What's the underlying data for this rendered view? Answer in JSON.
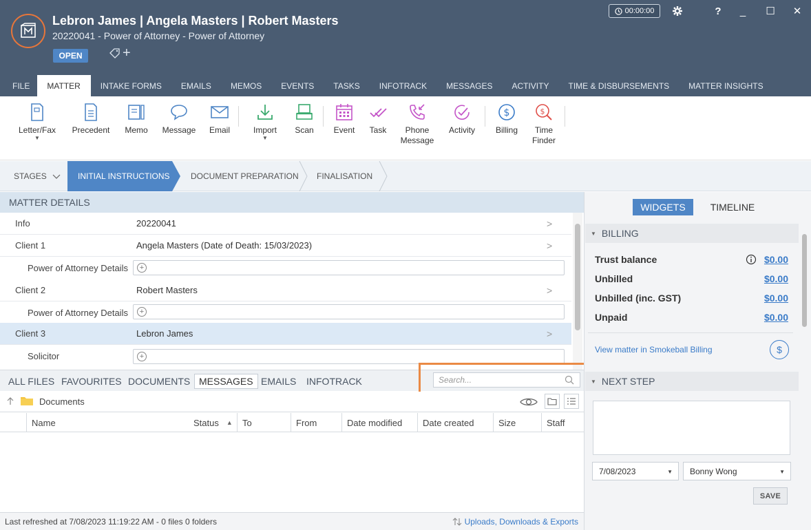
{
  "header": {
    "title": "Lebron James | Angela Masters | Robert Masters",
    "subtitle": "20220041 - Power of Attorney - Power of Attorney",
    "status_badge": "OPEN",
    "timer": "00:00:00",
    "help": "?",
    "minimize": "_",
    "maximize": "☐",
    "close": "✕"
  },
  "menu_tabs": [
    "FILE",
    "MATTER",
    "INTAKE FORMS",
    "EMAILS",
    "MEMOS",
    "EVENTS",
    "TASKS",
    "INFOTRACK",
    "MESSAGES",
    "ACTIVITY",
    "TIME & DISBURSEMENTS",
    "MATTER INSIGHTS"
  ],
  "active_menu_tab": "MATTER",
  "ribbon": {
    "letter_fax": "Letter/Fax",
    "precedent": "Precedent",
    "memo": "Memo",
    "message": "Message",
    "email": "Email",
    "import": "Import",
    "scan": "Scan",
    "event": "Event",
    "task": "Task",
    "phone_message_1": "Phone",
    "phone_message_2": "Message",
    "activity": "Activity",
    "billing": "Billing",
    "time_finder_1": "Time",
    "time_finder_2": "Finder"
  },
  "stages": {
    "stages_label": "STAGES",
    "initial": "INITIAL INSTRUCTIONS",
    "document_prep": "DOCUMENT PREPARATION",
    "finalisation": "FINALISATION"
  },
  "matter_details": {
    "header": "MATTER DETAILS",
    "info_label": "Info",
    "info_value": "20220041",
    "client1_label": "Client 1",
    "client1_value": "Angela Masters (Date of Death: 15/03/2023)",
    "poa1_label": "Power of Attorney Details",
    "client2_label": "Client 2",
    "client2_value": "Robert Masters",
    "poa2_label": "Power of Attorney Details",
    "client3_label": "Client 3",
    "client3_value": "Lebron James",
    "solicitor_label": "Solicitor"
  },
  "files_tabs": [
    "ALL FILES",
    "FAVOURITES",
    "DOCUMENTS",
    "MESSAGES",
    "EMAILS",
    "INFOTRACK"
  ],
  "active_files_tab": "MESSAGES",
  "search": {
    "placeholder": "Search..."
  },
  "docs_folder": "Documents",
  "grid_columns": {
    "name": "Name",
    "status": "Status",
    "to": "To",
    "from": "From",
    "date_modified": "Date modified",
    "date_created": "Date created",
    "size": "Size",
    "staff": "Staff"
  },
  "status_bar": {
    "left": "Last refreshed at 7/08/2023 11:19:22 AM  -  0 files  0 folders",
    "right": "Uploads, Downloads & Exports"
  },
  "right_panel": {
    "widgets": "WIDGETS",
    "timeline": "TIMELINE",
    "billing_header": "BILLING",
    "trust_balance_label": "Trust balance",
    "trust_balance_value": "$0.00",
    "unbilled_label": "Unbilled",
    "unbilled_value": "$0.00",
    "unbilled_gst_label": "Unbilled (inc. GST)",
    "unbilled_gst_value": "$0.00",
    "unpaid_label": "Unpaid",
    "unpaid_value": "$0.00",
    "view_billing_link": "View matter in Smokeball Billing",
    "next_step_header": "NEXT STEP",
    "date_value": "7/08/2023",
    "staff_value": "Bonny Wong",
    "save_label": "SAVE"
  },
  "colors": {
    "header_bg": "#4a5c72",
    "accent_blue": "#4f86c6",
    "highlight_orange": "#ea8a45",
    "link_blue": "#3a7bc8"
  }
}
